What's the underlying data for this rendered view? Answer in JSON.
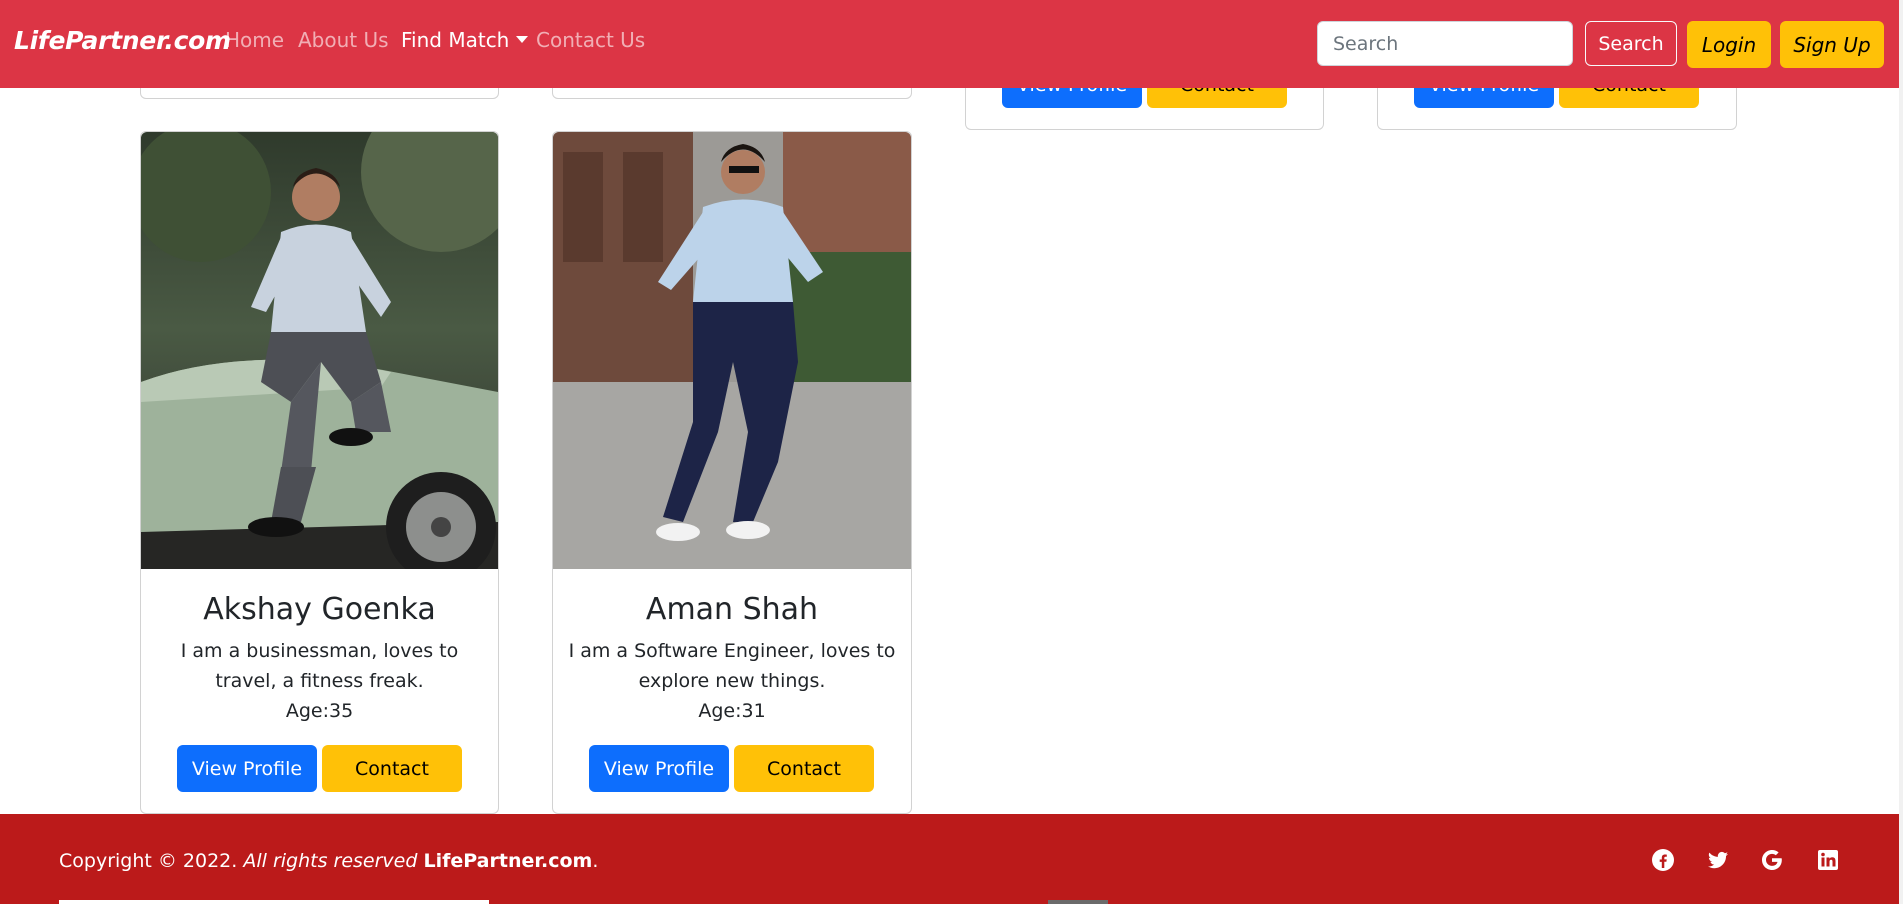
{
  "navbar": {
    "brand": "LifePartner.com",
    "links": [
      {
        "label": "Home"
      },
      {
        "label": "About Us"
      },
      {
        "label": "Find Match"
      },
      {
        "label": "Contact Us"
      }
    ],
    "search": {
      "placeholder": "Search",
      "button_label": "Search"
    },
    "login_label": "Login",
    "signup_label": "Sign Up"
  },
  "top_row": {
    "view_profile_label": "View Profile",
    "contact_label": "Contact"
  },
  "cards": [
    {
      "name": "Akshay Goenka",
      "description": "I am a businessman, loves to travel, a fitness freak.",
      "age": "Age:35",
      "view_profile_label": "View Profile",
      "contact_label": "Contact"
    },
    {
      "name": "Aman Shah",
      "description": "I am a Software Engineer, loves to explore new things.",
      "age": "Age:31",
      "view_profile_label": "View Profile",
      "contact_label": "Contact"
    }
  ],
  "footer": {
    "copyright": "Copyright © 2022.",
    "rights": "All rights reserved",
    "site": "LifePartner.com",
    "period": ".",
    "social_icons": [
      "facebook-icon",
      "twitter-icon",
      "google-icon",
      "linkedin-icon"
    ]
  },
  "colors": {
    "navbar": "#dc3545",
    "footer": "#bb1a1a",
    "primary": "#0d6efd",
    "warning": "#ffc107"
  }
}
